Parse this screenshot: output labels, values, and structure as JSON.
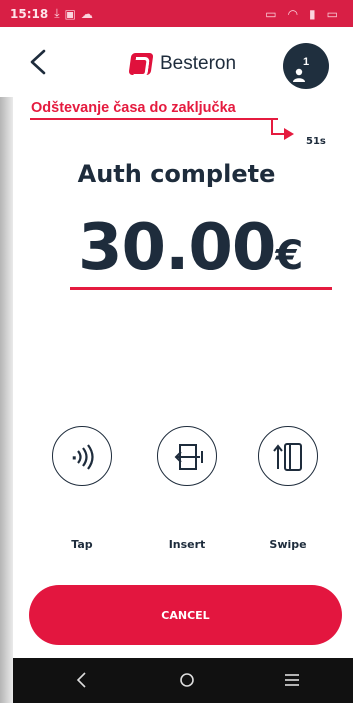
{
  "status_bar": {
    "time": "15:18"
  },
  "header": {
    "brand": "Besteron",
    "avatar_badge": "1"
  },
  "annotation": {
    "text": "Odštevanje časa do zaključka",
    "countdown": "51s"
  },
  "main": {
    "status_title": "Auth complete",
    "amount": "30.00",
    "currency": "€"
  },
  "methods": {
    "tap_label": "Tap",
    "insert_label": "Insert",
    "swipe_label": "Swipe"
  },
  "actions": {
    "cancel_label": "CANCEL"
  },
  "colors": {
    "accent": "#e3163f",
    "text": "#1e2c3c",
    "status_bar": "#d81f45"
  }
}
